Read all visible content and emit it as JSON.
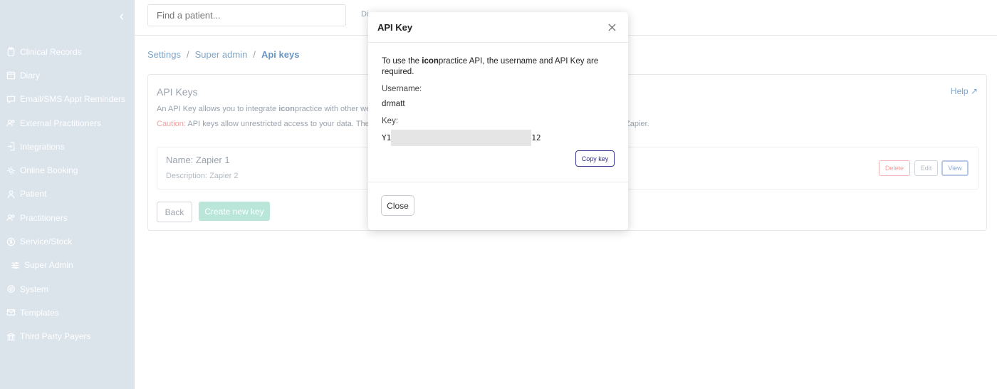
{
  "sidebar": {
    "collapse_icon": "chevron-left-icon",
    "items": [
      {
        "label": "Clinical Records",
        "icon": "clipboard-icon"
      },
      {
        "label": "Diary",
        "icon": "calendar-icon"
      },
      {
        "label": "Email/SMS Appt Reminders",
        "icon": "chat-icon"
      },
      {
        "label": "External Practitioners",
        "icon": "users-icon"
      },
      {
        "label": "Integrations",
        "icon": "login-icon"
      },
      {
        "label": "Online Booking",
        "icon": "sparkle-icon"
      },
      {
        "label": "Patient",
        "icon": "user-icon"
      },
      {
        "label": "Practitioners",
        "icon": "users-icon"
      },
      {
        "label": "Service/Stock",
        "icon": "dollar-icon"
      },
      {
        "label": "Super Admin",
        "icon": "sliders-icon"
      },
      {
        "label": "System",
        "icon": "gear-icon"
      },
      {
        "label": "Templates",
        "icon": "mail-icon"
      },
      {
        "label": "Third Party Payers",
        "icon": "bank-icon"
      }
    ]
  },
  "topbar": {
    "search_placeholder": "Find a patient...",
    "link_text": "Di"
  },
  "breadcrumb": {
    "items": [
      "Settings",
      "Super admin",
      "Api keys"
    ],
    "separator": "/"
  },
  "card": {
    "title": "API Keys",
    "help_label": "Help",
    "desc_prefix": "An API Key allows you to integrate ",
    "desc_brand": "icon",
    "desc_suffix": "practice with other we",
    "caution_label": "Caution:",
    "caution_text": " API keys allow unrestricted access to your data. The",
    "caution_tail": "Zapier.",
    "key_item": {
      "name": "Name: Zapier 1",
      "description": "Description: Zapier 2",
      "delete_label": "Delete",
      "edit_label": "Edit",
      "view_label": "View"
    },
    "back_label": "Back",
    "create_label": "Create new key"
  },
  "modal": {
    "title": "API Key",
    "intro_prefix": "To use the ",
    "intro_brand": "icon",
    "intro_suffix": "practice API, the username and API Key are required.",
    "username_label": "Username:",
    "username_value": "drmatt",
    "key_label": "Key:",
    "key_start": "Y1",
    "key_end": "12",
    "copy_label": "Copy key",
    "close_label": "Close"
  },
  "colors": {
    "sidebar_bg": "#dbe3eb",
    "accent": "#3d3a9a",
    "create_button": "#b9e6d8",
    "caution": "#f1a1a1"
  }
}
